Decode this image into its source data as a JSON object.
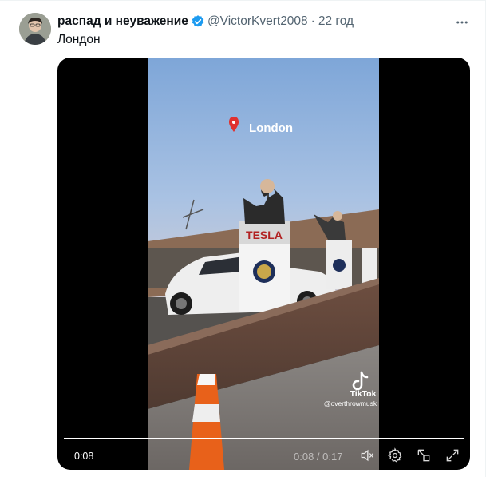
{
  "tweet": {
    "display_name": "распад и неуважение",
    "handle": "@VictorKvert2008",
    "separator": "·",
    "time": "22 год",
    "text": "Лондон",
    "verified_color": "#1d9bf0"
  },
  "video": {
    "overlay_location": "London",
    "watermark_brand": "TikTok",
    "watermark_user": "@overthrowmusk",
    "sign_text": "TESLA",
    "current_time": "0:08",
    "time_display": "0:08 / 0:17",
    "progress": 1.0
  },
  "icons": {
    "more": "more-dots-icon",
    "verified": "verified-badge-icon",
    "mute": "mute-icon",
    "settings": "gear-icon",
    "dock": "dock-icon",
    "fullscreen": "fullscreen-icon"
  }
}
